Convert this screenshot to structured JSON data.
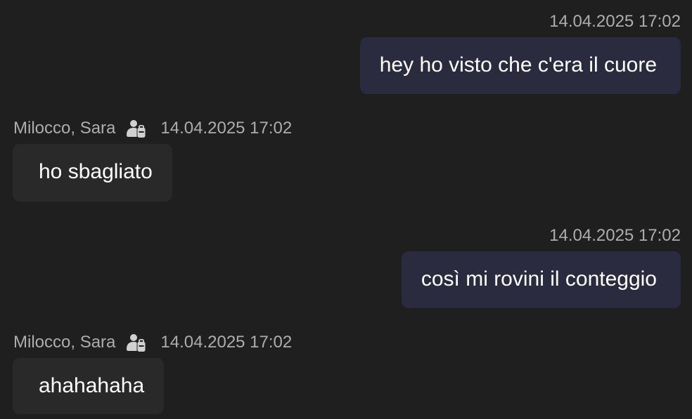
{
  "messages": [
    {
      "direction": "outgoing",
      "timestamp": "14.04.2025 17:02",
      "text": "hey ho visto che c'era il cuore"
    },
    {
      "direction": "incoming",
      "sender": "Milocco, Sara",
      "sender_icon": "external-user-icon",
      "timestamp": "14.04.2025 17:02",
      "text": "ho sbagliato"
    },
    {
      "direction": "outgoing",
      "timestamp": "14.04.2025 17:02",
      "text": "così mi rovini il conteggio"
    },
    {
      "direction": "incoming",
      "sender": "Milocco, Sara",
      "sender_icon": "external-user-icon",
      "timestamp": "14.04.2025 17:02",
      "text": "ahahahaha"
    }
  ],
  "colors": {
    "background": "#1f1f1f",
    "outgoing_bubble": "#2b2b40",
    "incoming_bubble": "#292929",
    "meta_text": "#adadad"
  }
}
